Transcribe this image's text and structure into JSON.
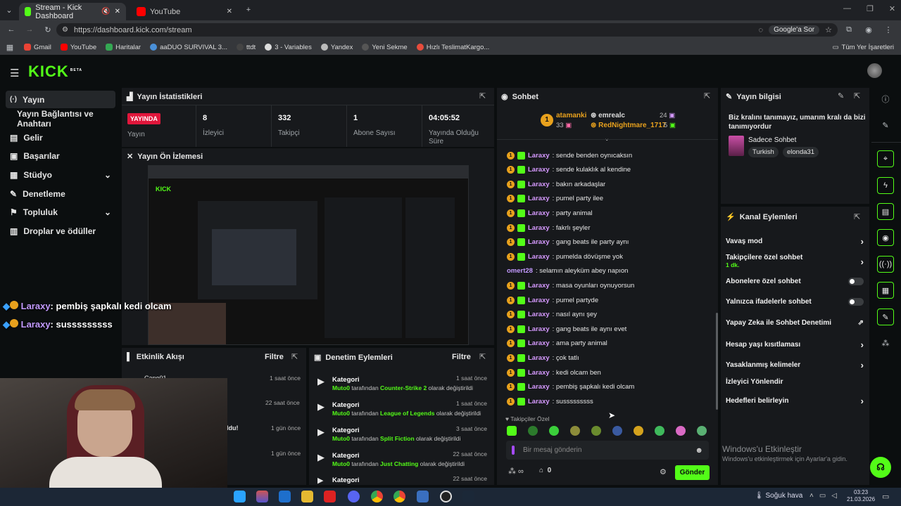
{
  "browser": {
    "tabs": [
      {
        "title": "Stream - Kick Dashboard"
      },
      {
        "title": "YouTube"
      }
    ],
    "url": "https://dashboard.kick.com/stream",
    "google_btn": "Google'a Sor",
    "bookmarks": [
      "Gmail",
      "YouTube",
      "Haritalar",
      "aaDUO SURVIVAL 3...",
      "ttdt",
      "3 - Variables",
      "Yandex",
      "Yeni Sekme",
      "Hızlı TeslimatKargo..."
    ],
    "all_bookmarks": "Tüm Yer İşaretleri"
  },
  "kick": {
    "logo": "KICK",
    "beta": "BETA"
  },
  "sidebar": {
    "items": [
      {
        "label": "Yayın",
        "icon": "broadcast-icon"
      },
      {
        "label": "Yayın Bağlantısı ve Anahtarı",
        "icon": ""
      },
      {
        "label": "Gelir",
        "icon": "money-icon"
      },
      {
        "label": "Başarılar",
        "icon": "trophy-icon"
      },
      {
        "label": "Stüdyo",
        "icon": "studio-icon"
      },
      {
        "label": "Denetleme",
        "icon": "wrench-icon"
      },
      {
        "label": "Topluluk",
        "icon": "community-icon"
      },
      {
        "label": "Droplar ve ödüller",
        "icon": "gift-icon"
      }
    ]
  },
  "stats": {
    "title": "Yayın İstatistikleri",
    "live_badge": "YAYINDA",
    "live_label": "Yayın",
    "viewers": "8",
    "viewers_label": "İzleyici",
    "followers": "332",
    "followers_label": "Takipçi",
    "subs": "1",
    "subs_label": "Abone Sayısı",
    "uptime": "04:05:52",
    "uptime_label": "Yayında Olduğu Süre"
  },
  "preview": {
    "title": "Yayın Ön İzlemesi"
  },
  "overlay_chat": [
    {
      "user": "Laraxy",
      "text": ": pembiş şapkalı kedi olcam"
    },
    {
      "user": "Laraxy",
      "text": ": susssssssss"
    }
  ],
  "activity": {
    "title": "Etkinlik Akışı",
    "filter": "Filtre",
    "items": [
      {
        "name": "Cano01",
        "time": "1 saat önce"
      },
      {
        "name": "",
        "time": "22 saat önce"
      },
      {
        "name": "ldu!",
        "time": "1 gün önce"
      },
      {
        "name": "",
        "time": "1 gün önce"
      }
    ]
  },
  "modlog": {
    "title": "Denetim Eylemleri",
    "filter": "Filtre",
    "items": [
      {
        "title": "Kategori",
        "time": "1 saat önce",
        "user": "Muto0",
        "mid": " tarafından ",
        "game": "Counter-Strike 2",
        "end": " olarak değiştirildi"
      },
      {
        "title": "Kategori",
        "time": "1 saat önce",
        "user": "Muto0",
        "mid": " tarafından ",
        "game": "League of Legends",
        "end": " olarak değiştirildi"
      },
      {
        "title": "Kategori",
        "time": "3 saat önce",
        "user": "Muto0",
        "mid": " tarafından ",
        "game": "Split Fiction",
        "end": " olarak değiştirildi"
      },
      {
        "title": "Kategori",
        "time": "22 saat önce",
        "user": "Muto0",
        "mid": " tarafından ",
        "game": "Just Chatting",
        "end": " olarak değiştirildi"
      },
      {
        "title": "Kategori",
        "time": "22 saat önce",
        "user": "",
        "mid": "",
        "game": "",
        "end": ""
      }
    ]
  },
  "chat": {
    "title": "Sohbet",
    "top": [
      {
        "rank": "1",
        "name": "atamanki",
        "count": "33"
      },
      {
        "name": "emrealc",
        "count": "24"
      },
      {
        "name": "RedNightmare_1717",
        "count": "5"
      }
    ],
    "messages": [
      {
        "user": "Laraxy",
        "text": ": sende benden oynıcaksın"
      },
      {
        "user": "Laraxy",
        "text": ": sende kulaklık al kendine"
      },
      {
        "user": "Laraxy",
        "text": ": bakın arkadaşlar"
      },
      {
        "user": "Laraxy",
        "text": ": pumel party ilee"
      },
      {
        "user": "Laraxy",
        "text": ": party animal"
      },
      {
        "user": "Laraxy",
        "text": ": fakrlı şeyler"
      },
      {
        "user": "Laraxy",
        "text": ": gang beats ile party aynı"
      },
      {
        "user": "Laraxy",
        "text": ": pumelda dövüşme yok"
      },
      {
        "user": "omert28",
        "text": ": selamın aleyküm abey napıon"
      },
      {
        "user": "Laraxy",
        "text": ": masa oyunları oynuyorsun"
      },
      {
        "user": "Laraxy",
        "text": ": pumel partyde"
      },
      {
        "user": "Laraxy",
        "text": ": nasıl aynı şey"
      },
      {
        "user": "Laraxy",
        "text": ": gang beats ile aynı evet"
      },
      {
        "user": "Laraxy",
        "text": ": ama party animal"
      },
      {
        "user": "Laraxy",
        "text": ": çok tatlı"
      },
      {
        "user": "Laraxy",
        "text": ": kedi olcam ben"
      },
      {
        "user": "Laraxy",
        "text": ": pembiş şapkalı kedi olcam"
      },
      {
        "user": "Laraxy",
        "text": ": susssssssss"
      }
    ],
    "followers_only": "Takipçiler Özel",
    "input_placeholder": "Bir mesaj gönderin",
    "points": "0",
    "send": "Gönder"
  },
  "info": {
    "title": "Yayın bilgisi",
    "stream_title": "Biz kralını tanımayız, umarım kralı da bizi tanımıyordur",
    "category": "Sadece Sohbet",
    "tags": [
      "Turkish",
      "elonda31"
    ]
  },
  "channel_actions": {
    "title": "Kanal Eylemleri",
    "items": [
      {
        "label": "Vavaş mod",
        "type": "chevron",
        "sub": ""
      },
      {
        "label": "Takipçilere özel sohbet",
        "type": "chevron",
        "sub": "1 dk."
      },
      {
        "label": "Abonelere özel sohbet",
        "type": "toggle",
        "sub": ""
      },
      {
        "label": "Yalnızca ifadelerle sohbet",
        "type": "toggle",
        "sub": ""
      },
      {
        "label": "Yapay Zeka ile Sohbet Denetimi",
        "type": "external",
        "sub": ""
      },
      {
        "label": "Hesap yaşı kısıtlaması",
        "type": "chevron",
        "sub": ""
      },
      {
        "label": "Yasaklanmış kelimeler",
        "type": "chevron",
        "sub": ""
      },
      {
        "label": "İzleyici Yönlendir",
        "type": "none",
        "sub": ""
      },
      {
        "label": "Hedefleri belirleyin",
        "type": "chevron",
        "sub": ""
      }
    ]
  },
  "watermark": {
    "line1": "Windows'u Etkinleştir",
    "line2": "Windows'u etkinleştirmek için Ayarlar'a gidin."
  },
  "taskbar": {
    "weather": "Soğuk hava",
    "time": "03:23",
    "date": "21.03.2026"
  },
  "colors": {
    "kick_green": "#53fc18",
    "live_red": "#e0163b",
    "username": "#d69aff"
  }
}
